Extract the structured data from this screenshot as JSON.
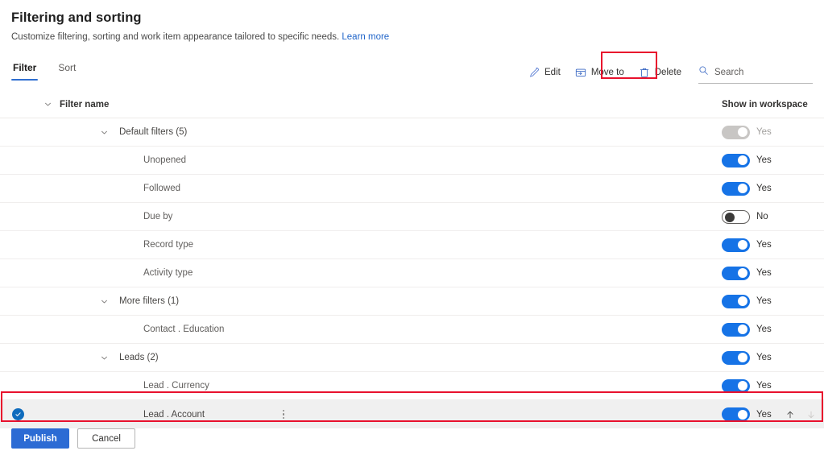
{
  "header": {
    "title": "Filtering and sorting",
    "subtitle": "Customize filtering, sorting and work item appearance tailored to specific needs.",
    "learn_more": "Learn more"
  },
  "tabs": [
    {
      "label": "Filter",
      "active": true
    },
    {
      "label": "Sort",
      "active": false
    }
  ],
  "toolbar": {
    "edit_label": "Edit",
    "move_to_label": "Move to",
    "delete_label": "Delete",
    "search_placeholder": "Search",
    "search_value": "",
    "highlighted_command": "Move to",
    "highlight_color": "#e8112d"
  },
  "table": {
    "columns": {
      "name": "Filter name",
      "workspace": "Show in workspace"
    },
    "rows": [
      {
        "name": "Default filters (5)",
        "type": "group",
        "toggle": "disabled",
        "toggle_label": "Yes"
      },
      {
        "name": "Unopened",
        "type": "leaf",
        "toggle": "on",
        "toggle_label": "Yes"
      },
      {
        "name": "Followed",
        "type": "leaf",
        "toggle": "on",
        "toggle_label": "Yes"
      },
      {
        "name": "Due by",
        "type": "leaf",
        "toggle": "off",
        "toggle_label": "No"
      },
      {
        "name": "Record type",
        "type": "leaf",
        "toggle": "on",
        "toggle_label": "Yes"
      },
      {
        "name": "Activity type",
        "type": "leaf",
        "toggle": "on",
        "toggle_label": "Yes"
      },
      {
        "name": "More filters (1)",
        "type": "group",
        "toggle": "on",
        "toggle_label": "Yes"
      },
      {
        "name": "Contact . Education",
        "type": "leaf",
        "toggle": "on",
        "toggle_label": "Yes"
      },
      {
        "name": "Leads (2)",
        "type": "group",
        "toggle": "on",
        "toggle_label": "Yes"
      },
      {
        "name": "Lead . Currency",
        "type": "leaf",
        "toggle": "on",
        "toggle_label": "Yes"
      },
      {
        "name": "Lead . Account",
        "type": "leaf",
        "toggle": "on",
        "toggle_label": "Yes",
        "selected": true
      }
    ]
  },
  "selected_row": {
    "name": "Lead . Account",
    "checked": true,
    "move_up_enabled": true,
    "move_down_enabled": false
  },
  "footer": {
    "publish_label": "Publish",
    "cancel_label": "Cancel"
  },
  "colors": {
    "accent_blue": "#2c6bd4",
    "toggle_on": "#1673e6",
    "link_blue": "#2266c9",
    "highlight_red": "#e8112d",
    "selected_row_bg": "#f0f0f0"
  }
}
